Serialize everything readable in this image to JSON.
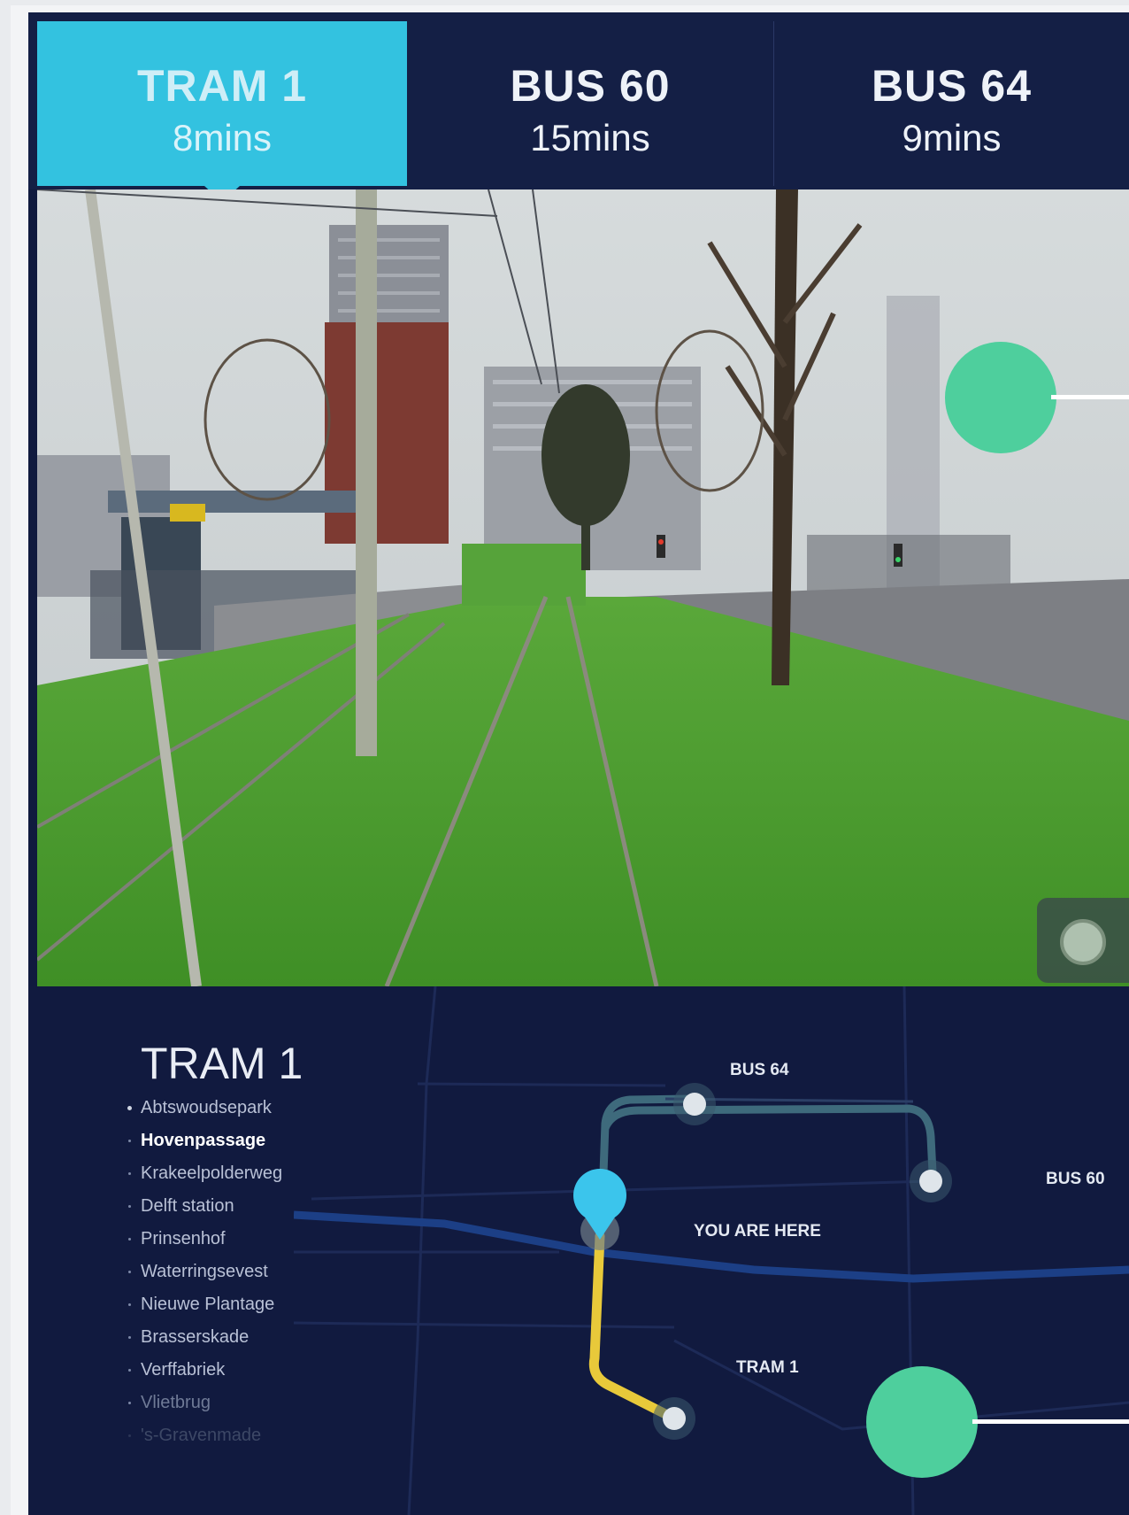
{
  "tabs": [
    {
      "name": "TRAM 1",
      "time": "8mins",
      "active": true
    },
    {
      "name": "BUS 60",
      "time": "15mins",
      "active": false
    },
    {
      "name": "BUS 64",
      "time": "9mins",
      "active": false
    }
  ],
  "route": {
    "title": "TRAM 1",
    "stops": [
      {
        "label": "Abtswoudsepark"
      },
      {
        "label": "Hovenpassage",
        "current": true
      },
      {
        "label": "Krakeelpolderweg"
      },
      {
        "label": "Delft station"
      },
      {
        "label": "Prinsenhof"
      },
      {
        "label": "Waterringsevest"
      },
      {
        "label": "Nieuwe Plantage"
      },
      {
        "label": "Brasserskade"
      },
      {
        "label": "Verffabriek"
      },
      {
        "label": "Vlietbrug"
      },
      {
        "label": "'s-Gravenmade"
      }
    ]
  },
  "map": {
    "you_are_here": "YOU ARE HERE",
    "labels": {
      "bus64": "BUS 64",
      "bus60": "BUS 60",
      "tram1": "TRAM 1"
    }
  },
  "colors": {
    "accent": "#33c2e0",
    "marker": "#4ecf9d",
    "route_line": "#e8c93a",
    "background": "#101a3e"
  }
}
